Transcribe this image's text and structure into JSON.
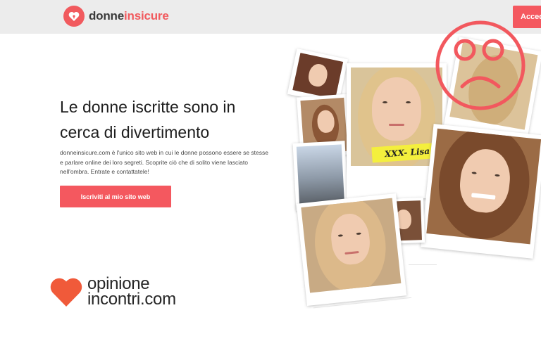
{
  "header": {
    "logo_word_1": "donne",
    "logo_word_2": "insicure",
    "login_label": "Accedi"
  },
  "hero": {
    "headline_line_1": "Le donne iscritte sono in",
    "headline_line_2": "cerca di divertimento",
    "description": "donneinsicure.com è l'unico sito web in cui le donne possono essere se stesse e parlare online dei loro segreti. Scoprite ciò che di solito viene lasciato nell'ombra. Entrate e contattatele!",
    "cta_label": "Iscriviti al mio sito web"
  },
  "collage": {
    "tag_text": "XXX- Lisa"
  },
  "watermark": {
    "line_1": "opinione",
    "line_2a": "incontri",
    "line_2b": ".com"
  },
  "colors": {
    "accent": "#f4585f",
    "header_bg": "#ececec",
    "heart": "#f05a3a",
    "tag_yellow": "#f4ef3d"
  }
}
